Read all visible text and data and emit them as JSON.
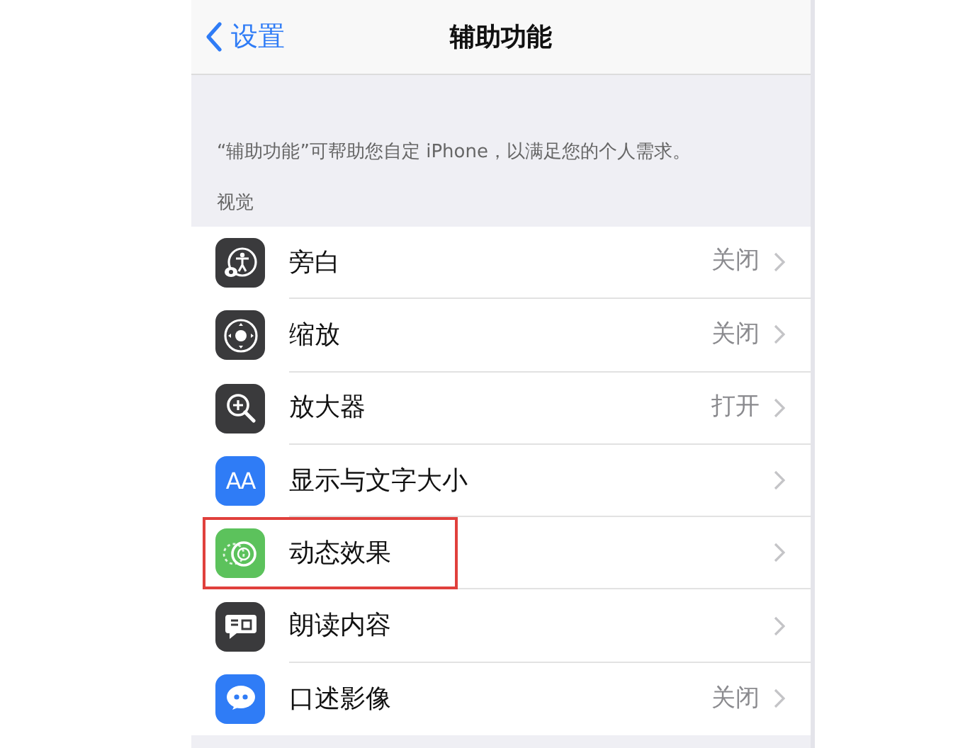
{
  "nav": {
    "back": "设置",
    "title": "辅助功能"
  },
  "description": "“辅助功能”可帮助您自定 iPhone，以满足您的个人需求。",
  "section": "视觉",
  "items": [
    {
      "kind": "voiceover",
      "label": "旁白",
      "value": "关闭",
      "highlighted": false
    },
    {
      "kind": "zoom",
      "label": "缩放",
      "value": "关闭",
      "highlighted": false
    },
    {
      "kind": "magnifier",
      "label": "放大器",
      "value": "打开",
      "highlighted": false
    },
    {
      "kind": "display",
      "icon_text": "AA",
      "label": "显示与文字大小",
      "highlighted": false
    },
    {
      "kind": "motion",
      "label": "动态效果",
      "highlighted": true
    },
    {
      "kind": "spoken",
      "label": "朗读内容",
      "highlighted": false
    },
    {
      "kind": "audio",
      "label": "口述影像",
      "value": "关闭",
      "highlighted": false
    }
  ]
}
